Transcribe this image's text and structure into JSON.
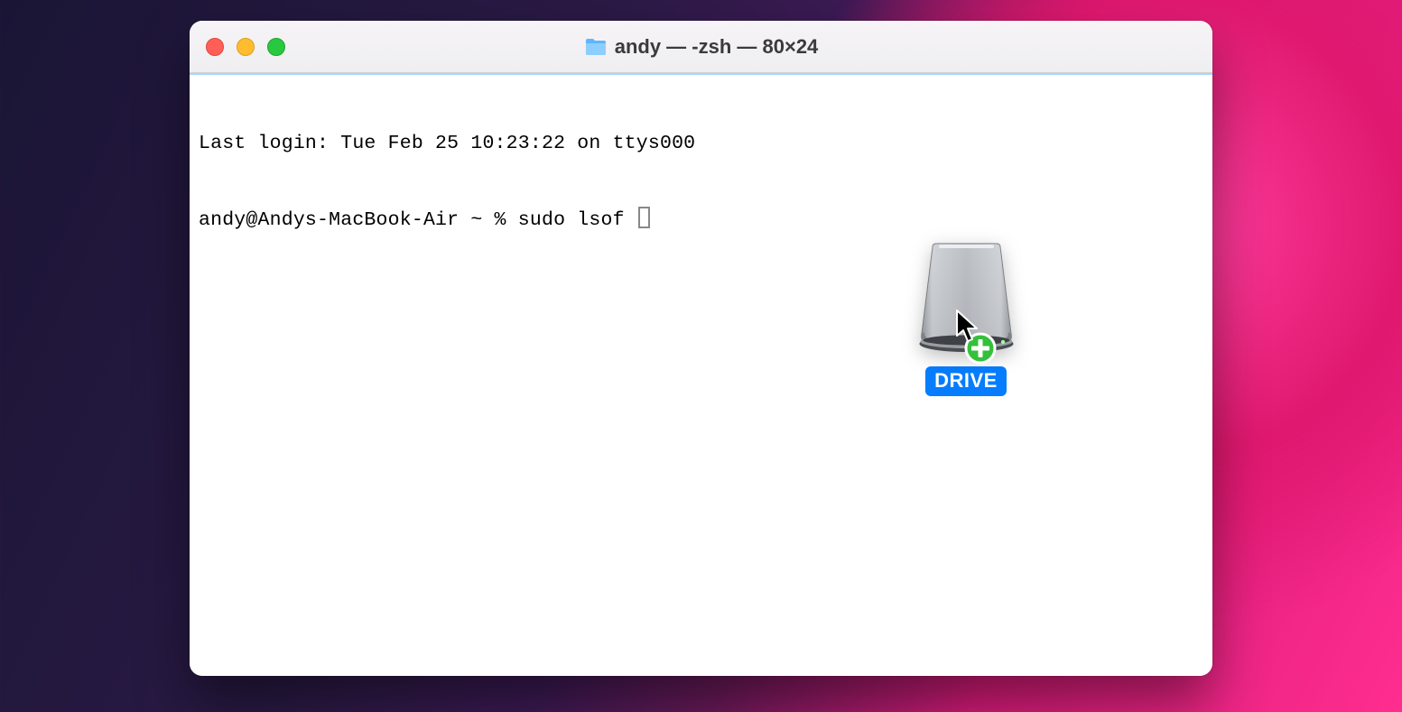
{
  "window": {
    "title": "andy — -zsh — 80×24",
    "folder_icon": "folder-icon"
  },
  "terminal": {
    "line1": "Last login: Tue Feb 25 10:23:22 on ttys000",
    "prompt": "andy@Andys-MacBook-Air ~ % ",
    "command": "sudo lsof "
  },
  "drag": {
    "icon": "external-drive-icon",
    "badge": "add-plus-badge",
    "label": "DRIVE"
  }
}
